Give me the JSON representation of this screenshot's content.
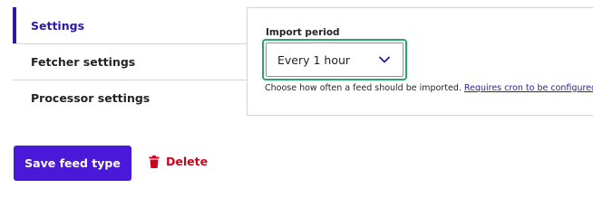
{
  "tabs": [
    {
      "label": "Settings",
      "active": true
    },
    {
      "label": "Fetcher settings",
      "active": false
    },
    {
      "label": "Processor settings",
      "active": false
    }
  ],
  "import_period": {
    "label": "Import period",
    "value": "Every 1 hour",
    "description": "Choose how often a feed should be imported.",
    "link_text": "Requires cron to be configured."
  },
  "actions": {
    "save_label": "Save feed type",
    "delete_label": "Delete"
  },
  "colors": {
    "accent": "#4a18d8",
    "active_tab": "#2a1aa6",
    "focus_ring": "#26a769",
    "danger": "#d0021b"
  },
  "icons": {
    "select": "chevron-down-icon",
    "delete": "trash-icon"
  }
}
